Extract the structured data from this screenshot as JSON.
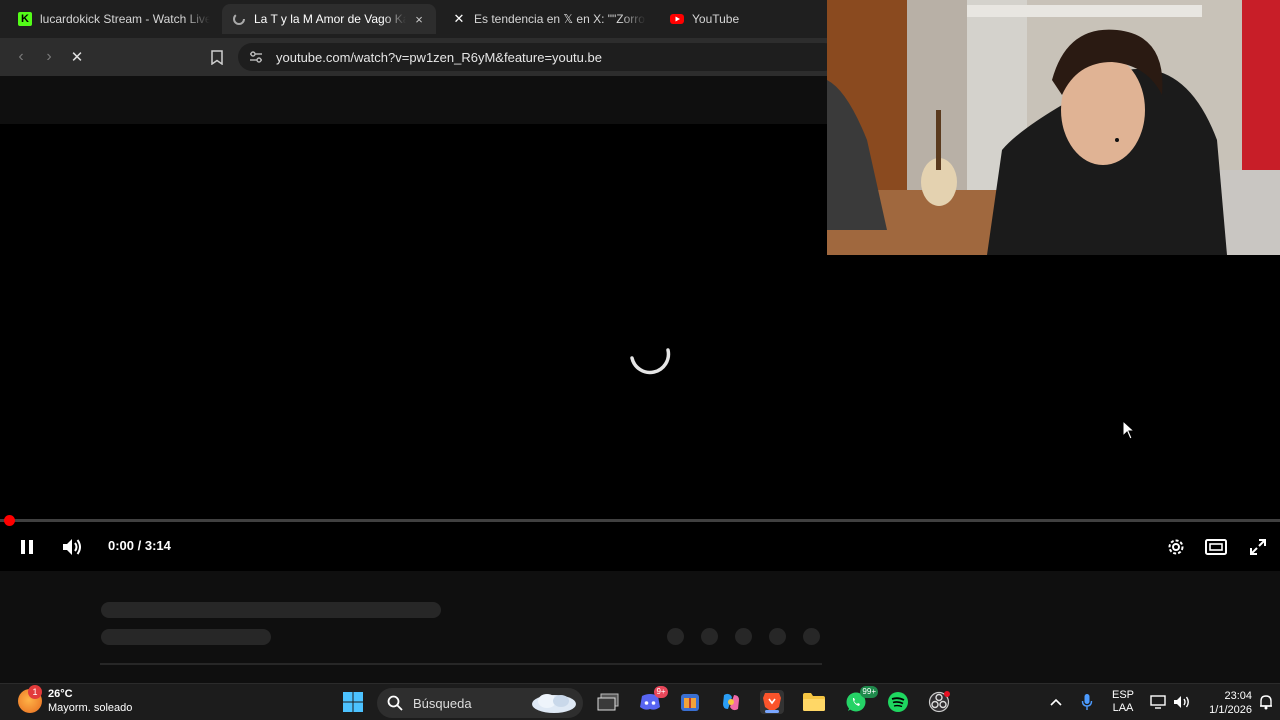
{
  "browser": {
    "tabs": [
      {
        "title": "lucardokick Stream - Watch Live o",
        "favicon": "kick-icon",
        "active": false
      },
      {
        "title": "La T y la M Amor de Vago Kar",
        "favicon": "loading-icon",
        "active": true,
        "close": "×"
      },
      {
        "title": "Es tendencia en 𝕏 en X: \"\"Zorro\": R",
        "favicon": "x-icon",
        "active": false
      },
      {
        "title": "YouTube",
        "favicon": "youtube-icon",
        "active": false
      }
    ],
    "url": "youtube.com/watch?v=pw1zen_R6yM&feature=youtu.be"
  },
  "player": {
    "time_current": "0:00",
    "time_total": "3:14",
    "time_display": "0:00 / 3:14",
    "progress": 0.0,
    "state": "loading",
    "controls": [
      "pause-icon",
      "volume-icon",
      "settings-icon",
      "theater-mode-icon",
      "fullscreen-icon"
    ]
  },
  "taskbar": {
    "weather_temp": "26°C",
    "weather_desc": "Mayorm. soleado",
    "weather_badge": "1",
    "search_placeholder": "Búsqueda",
    "discord_badge": "9+",
    "whatsapp_badge": "99+",
    "lang_top": "ESP",
    "lang_bottom": "LAA",
    "time": "23:04",
    "date": "1/1/2026"
  },
  "colors": {
    "accent_red": "#ff0000",
    "tab_bg": "#1f1f1f",
    "toolbar_bg": "#2d2d2d",
    "page_bg": "#0f0f0f"
  }
}
